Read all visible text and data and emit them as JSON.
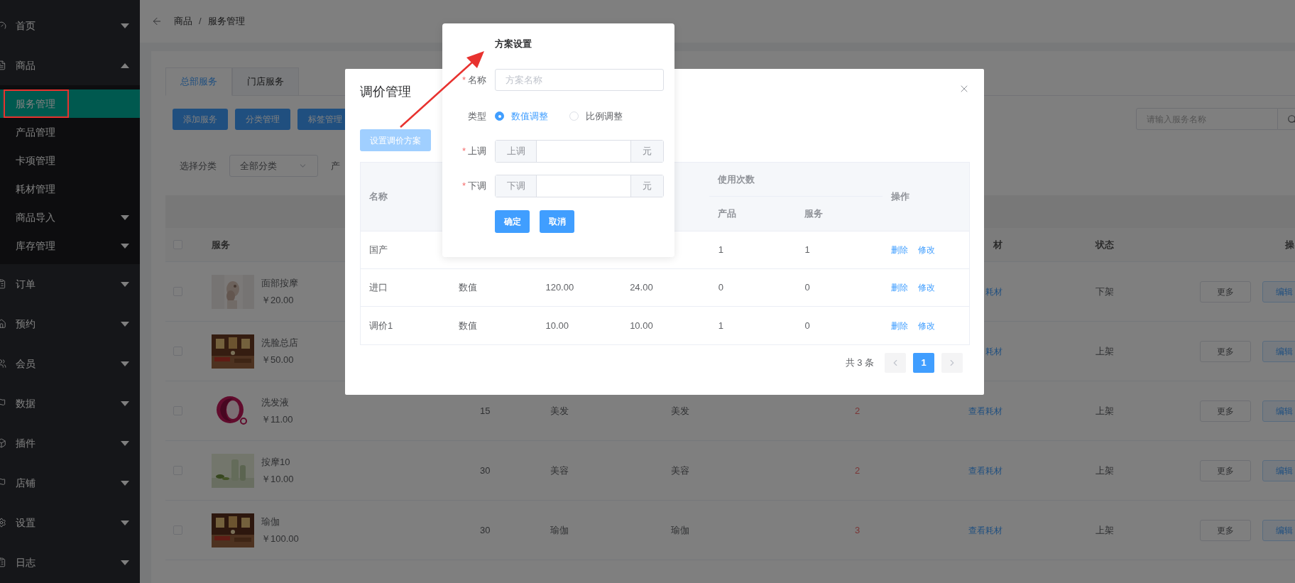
{
  "sidebar": {
    "items": [
      {
        "label": "首页",
        "expanded": false
      },
      {
        "label": "商品",
        "expanded": true,
        "children": [
          {
            "label": "服务管理",
            "selected": true
          },
          {
            "label": "产品管理",
            "selected": false
          },
          {
            "label": "卡项管理",
            "selected": false
          },
          {
            "label": "耗材管理",
            "selected": false
          },
          {
            "label": "商品导入",
            "selected": false,
            "expanded": false
          },
          {
            "label": "库存管理",
            "selected": false,
            "expanded": false
          }
        ]
      },
      {
        "label": "订单",
        "expanded": false
      },
      {
        "label": "预约",
        "expanded": false
      },
      {
        "label": "会员",
        "expanded": false
      },
      {
        "label": "数据",
        "expanded": false
      },
      {
        "label": "插件",
        "expanded": false
      },
      {
        "label": "店铺",
        "expanded": false
      },
      {
        "label": "设置",
        "expanded": false
      },
      {
        "label": "日志",
        "expanded": false
      }
    ]
  },
  "breadcrumb": {
    "items": [
      "商品",
      "服务管理"
    ],
    "separator": "/"
  },
  "tabs": [
    {
      "label": "总部服务",
      "selected": true
    },
    {
      "label": "门店服务",
      "selected": false
    }
  ],
  "toolbar_buttons": [
    "添加服务",
    "分类管理",
    "标签管理"
  ],
  "search": {
    "placeholder": "请输入服务名称"
  },
  "filter": {
    "label": "选择分类",
    "value": "全部分类",
    "next_label": "产"
  },
  "table": {
    "header": {
      "checked": false,
      "service": "服务",
      "material": "材",
      "status": "状态",
      "actions": "操"
    },
    "rows": [
      {
        "checked": false,
        "kind": "picture",
        "name": "面部按摩",
        "price": "￥20.00",
        "material": "耗材",
        "status": "下架",
        "actions": [
          "更多",
          "编辑"
        ]
      },
      {
        "checked": false,
        "kind": "picture",
        "name": "洗脸总店",
        "price": "￥50.00",
        "material": "耗材",
        "status": "上架",
        "actions": [
          "更多",
          "编辑"
        ]
      },
      {
        "checked": false,
        "kind": "picture",
        "name": "洗发液",
        "price": "￥11.00",
        "count": "15",
        "category": "美发",
        "tag": "美发",
        "uses": "2",
        "material": "查看耗材",
        "status": "上架",
        "actions": [
          "更多",
          "编辑"
        ]
      },
      {
        "checked": false,
        "kind": "picture",
        "name": "按摩10",
        "price": "￥10.00",
        "count": "30",
        "category": "美容",
        "tag": "美容",
        "uses": "2",
        "material": "查看耗材",
        "status": "上架",
        "actions": [
          "更多",
          "编辑"
        ]
      },
      {
        "checked": false,
        "kind": "picture",
        "name": "瑜伽",
        "price": "￥100.00",
        "count": "30",
        "category": "瑜伽",
        "tag": "瑜伽",
        "uses": "3",
        "material": "查看耗材",
        "status": "上架",
        "actions": [
          "更多",
          "编辑"
        ]
      }
    ]
  },
  "modal": {
    "title": "调价管理",
    "set_button": "设置调价方案",
    "table": {
      "header": {
        "name": "名称",
        "usage": "使用次数",
        "product": "产品",
        "service": "服务",
        "actions": "操作"
      },
      "rows": [
        {
          "name": "国产",
          "product": "1",
          "service": "1",
          "actions": [
            "删除",
            "修改"
          ]
        },
        {
          "name": "进口",
          "type": "数值",
          "up": "120.00",
          "down": "24.00",
          "product": "0",
          "service": "0",
          "actions": [
            "删除",
            "修改"
          ]
        },
        {
          "name": "调价1",
          "type": "数值",
          "up": "10.00",
          "down": "10.00",
          "product": "1",
          "service": "0",
          "actions": [
            "删除",
            "修改"
          ]
        }
      ]
    },
    "pagination": {
      "total": "共 3 条",
      "pages": [
        {
          "label": "1",
          "selected": true
        }
      ]
    }
  },
  "popover": {
    "title": "方案设置",
    "fields": [
      {
        "kind": "text",
        "label": "名称",
        "required_mark": "*",
        "placeholder": "方案名称"
      },
      {
        "kind": "radio",
        "label": "类型",
        "options": [
          {
            "label": "数值调整",
            "selected": true
          },
          {
            "label": "比例调整",
            "selected": false
          }
        ]
      },
      {
        "kind": "amount",
        "label": "上调",
        "required_mark": "*",
        "prefix": "上调",
        "suffix": "元"
      },
      {
        "kind": "amount",
        "label": "下调",
        "required_mark": "*",
        "prefix": "下调",
        "suffix": "元"
      }
    ],
    "buttons": [
      "确定",
      "取消"
    ]
  }
}
